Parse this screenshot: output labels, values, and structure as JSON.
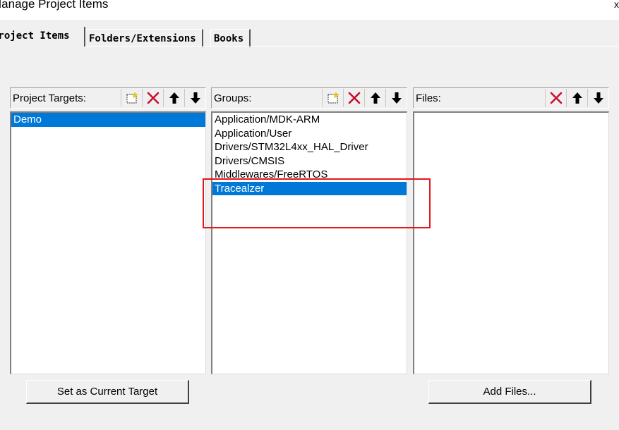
{
  "window": {
    "title": "Manage Project Items",
    "close_glyph": "x"
  },
  "tabs": [
    {
      "label": "Project Items",
      "active": true
    },
    {
      "label": "Folders/Extensions",
      "active": false
    },
    {
      "label": "Books",
      "active": false
    }
  ],
  "targets": {
    "label": "Project Targets:",
    "items": [
      "Demo"
    ],
    "selected_index": 0,
    "tools": [
      "new-icon",
      "delete-icon",
      "move-up-icon",
      "move-down-icon"
    ]
  },
  "groups": {
    "label": "Groups:",
    "items": [
      "Application/MDK-ARM",
      "Application/User",
      "Drivers/STM32L4xx_HAL_Driver",
      "Drivers/CMSIS",
      "Middlewares/FreeRTOS",
      "Tracealzer"
    ],
    "selected_index": 5,
    "tools": [
      "new-icon",
      "delete-icon",
      "move-up-icon",
      "move-down-icon"
    ]
  },
  "files": {
    "label": "Files:",
    "items": [],
    "tools": [
      "delete-icon",
      "move-up-icon",
      "move-down-icon"
    ]
  },
  "buttons": {
    "set_current_target": "Set as Current Target",
    "add_files": "Add Files..."
  },
  "colors": {
    "selection": "#0078d7",
    "delete_icon": "#c8102e",
    "annotation_box": "#e3161a",
    "dialog_bg": "#f0f0f0"
  }
}
